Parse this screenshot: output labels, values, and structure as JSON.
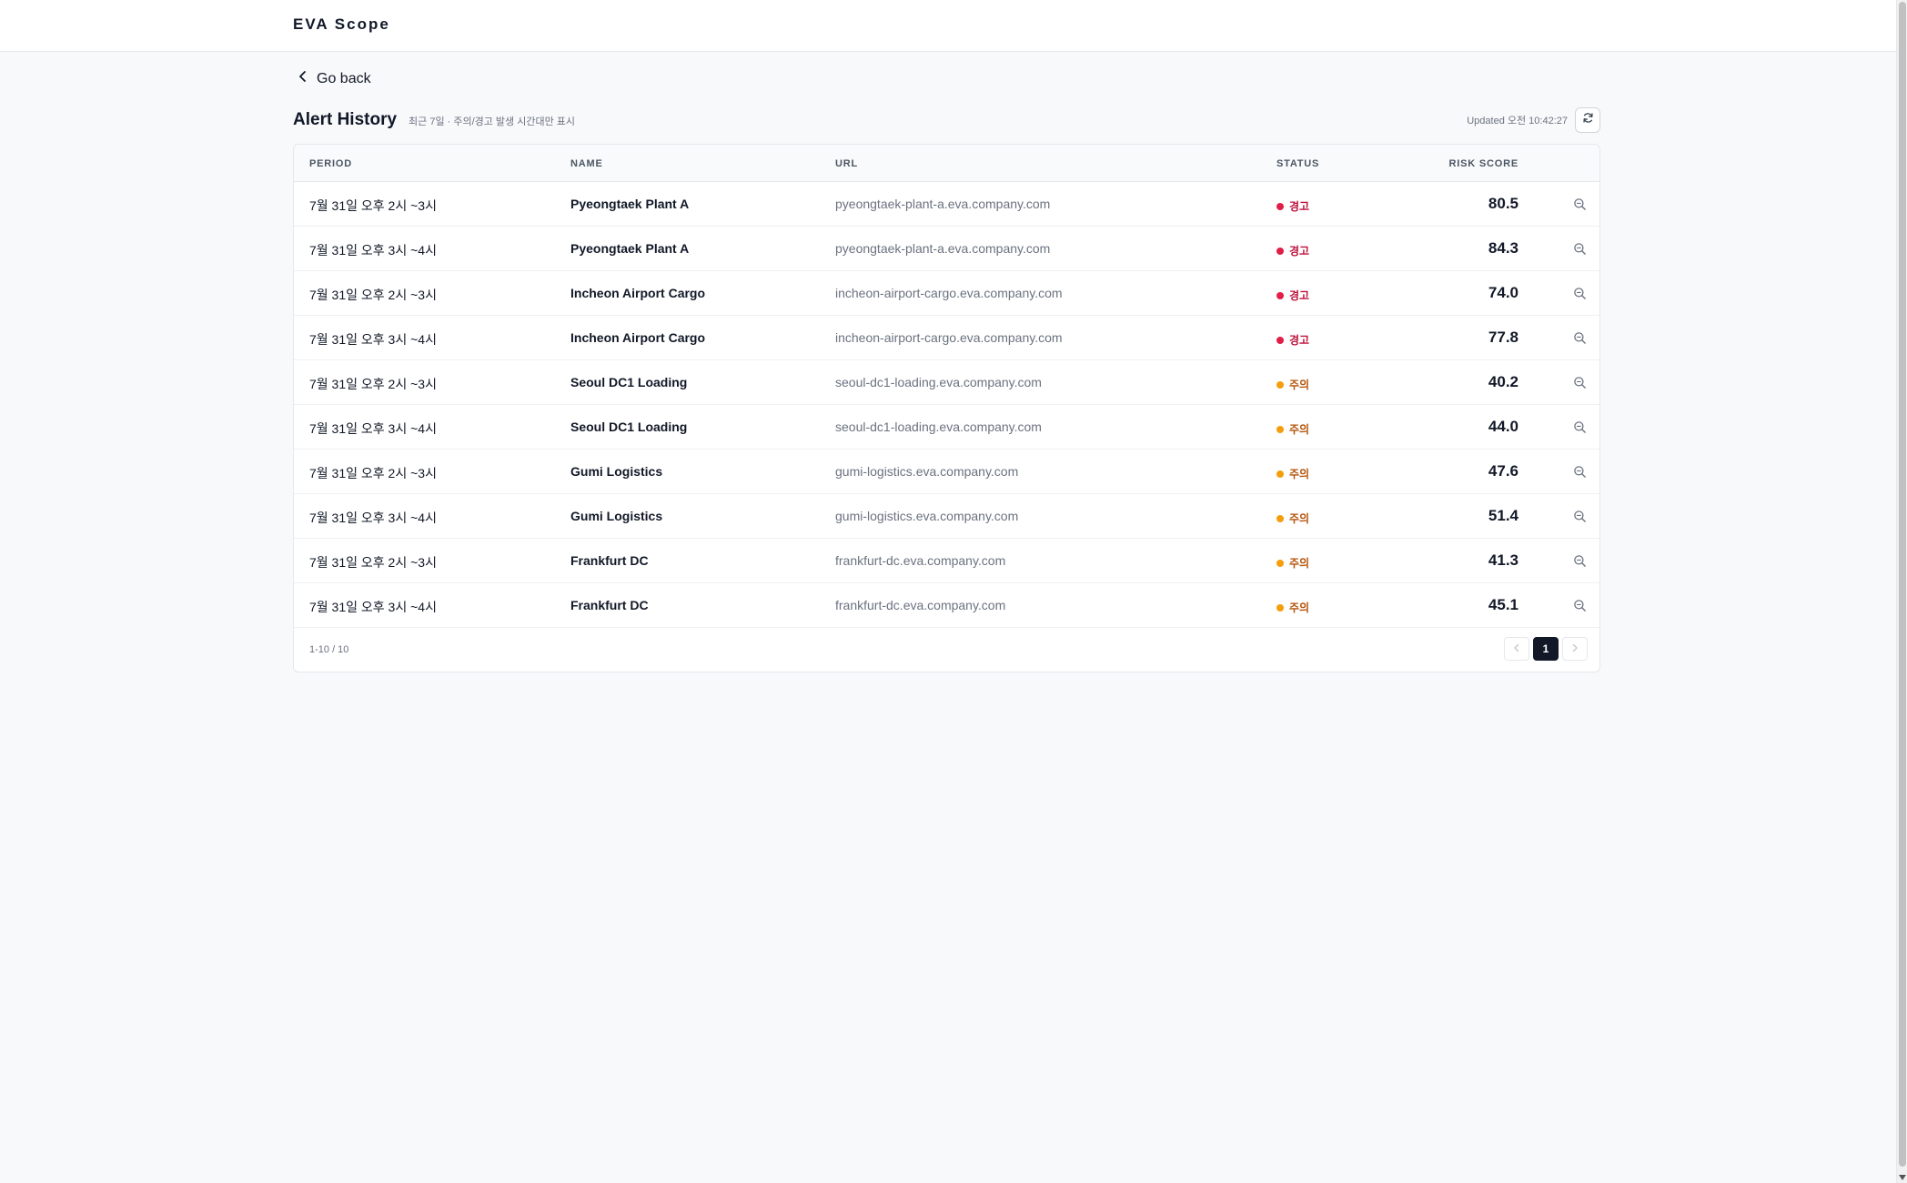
{
  "app": {
    "title": "EVA Scope"
  },
  "nav": {
    "go_back": "Go back"
  },
  "page": {
    "title": "Alert History",
    "subtitle": "최근 7일 · 주의/경고 발생 시간대만 표시",
    "updated": "Updated 오전 10:42:27"
  },
  "table": {
    "headers": {
      "period": "PERIOD",
      "name": "NAME",
      "url": "URL",
      "status": "STATUS",
      "risk_score": "RISK SCORE"
    },
    "status_colors": {
      "경고": "#e11d48",
      "주의": "#f59e0b"
    },
    "status_text_colors": {
      "경고": "#be123c",
      "주의": "#b45309"
    },
    "rows": [
      {
        "period": "7월 31일 오후 2시 ~3시",
        "name": "Pyeongtaek Plant A",
        "url": "pyeongtaek-plant-a.eva.company.com",
        "status": "경고",
        "score": "80.5",
        "action_icon": "zoom-icon"
      },
      {
        "period": "7월 31일 오후 3시 ~4시",
        "name": "Pyeongtaek Plant A",
        "url": "pyeongtaek-plant-a.eva.company.com",
        "status": "경고",
        "score": "84.3",
        "action_icon": "zoom-icon"
      },
      {
        "period": "7월 31일 오후 2시 ~3시",
        "name": "Incheon Airport Cargo",
        "url": "incheon-airport-cargo.eva.company.com",
        "status": "경고",
        "score": "74.0",
        "action_icon": "zoom-icon"
      },
      {
        "period": "7월 31일 오후 3시 ~4시",
        "name": "Incheon Airport Cargo",
        "url": "incheon-airport-cargo.eva.company.com",
        "status": "경고",
        "score": "77.8",
        "action_icon": "zoom-icon"
      },
      {
        "period": "7월 31일 오후 2시 ~3시",
        "name": "Seoul DC1 Loading",
        "url": "seoul-dc1-loading.eva.company.com",
        "status": "주의",
        "score": "40.2",
        "action_icon": "zoom-icon"
      },
      {
        "period": "7월 31일 오후 3시 ~4시",
        "name": "Seoul DC1 Loading",
        "url": "seoul-dc1-loading.eva.company.com",
        "status": "주의",
        "score": "44.0",
        "action_icon": "zoom-icon"
      },
      {
        "period": "7월 31일 오후 2시 ~3시",
        "name": "Gumi Logistics",
        "url": "gumi-logistics.eva.company.com",
        "status": "주의",
        "score": "47.6",
        "action_icon": "zoom-icon"
      },
      {
        "period": "7월 31일 오후 3시 ~4시",
        "name": "Gumi Logistics",
        "url": "gumi-logistics.eva.company.com",
        "status": "주의",
        "score": "51.4",
        "action_icon": "zoom-icon"
      },
      {
        "period": "7월 31일 오후 2시 ~3시",
        "name": "Frankfurt DC",
        "url": "frankfurt-dc.eva.company.com",
        "status": "주의",
        "score": "41.3",
        "action_icon": "zoom-icon"
      },
      {
        "period": "7월 31일 오후 3시 ~4시",
        "name": "Frankfurt DC",
        "url": "frankfurt-dc.eva.company.com",
        "status": "주의",
        "score": "45.1",
        "action_icon": "zoom-icon"
      }
    ]
  },
  "pagination": {
    "count_label": "1-10 / 10",
    "current_page": "1"
  }
}
